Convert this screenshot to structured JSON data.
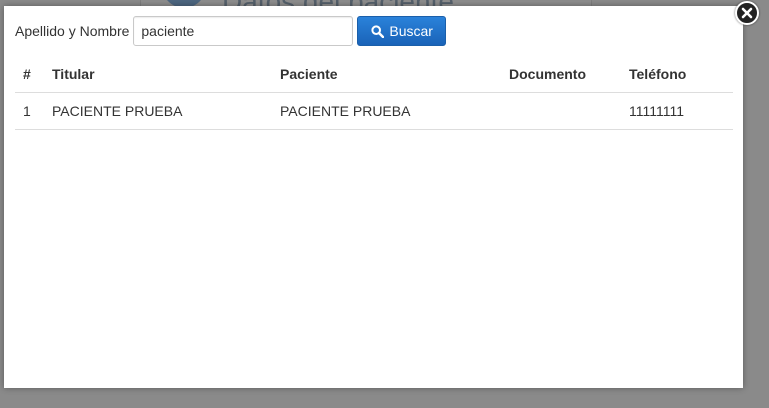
{
  "background": {
    "heading": "Datos del paciente"
  },
  "search": {
    "label": "Apellido y Nombre",
    "value": "paciente",
    "button_label": "Buscar",
    "button_icon": "search-icon"
  },
  "close_icon": "close-icon",
  "table": {
    "headers": {
      "num": "#",
      "titular": "Titular",
      "paciente": "Paciente",
      "documento": "Documento",
      "telefono": "Teléfono"
    },
    "rows": [
      {
        "num": "1",
        "titular": "PACIENTE PRUEBA",
        "paciente": "PACIENTE PRUEBA",
        "documento": "",
        "telefono": "11111111"
      }
    ]
  },
  "colors": {
    "primary_button": "#1a63b8",
    "overlay": "#8a8a8a"
  }
}
